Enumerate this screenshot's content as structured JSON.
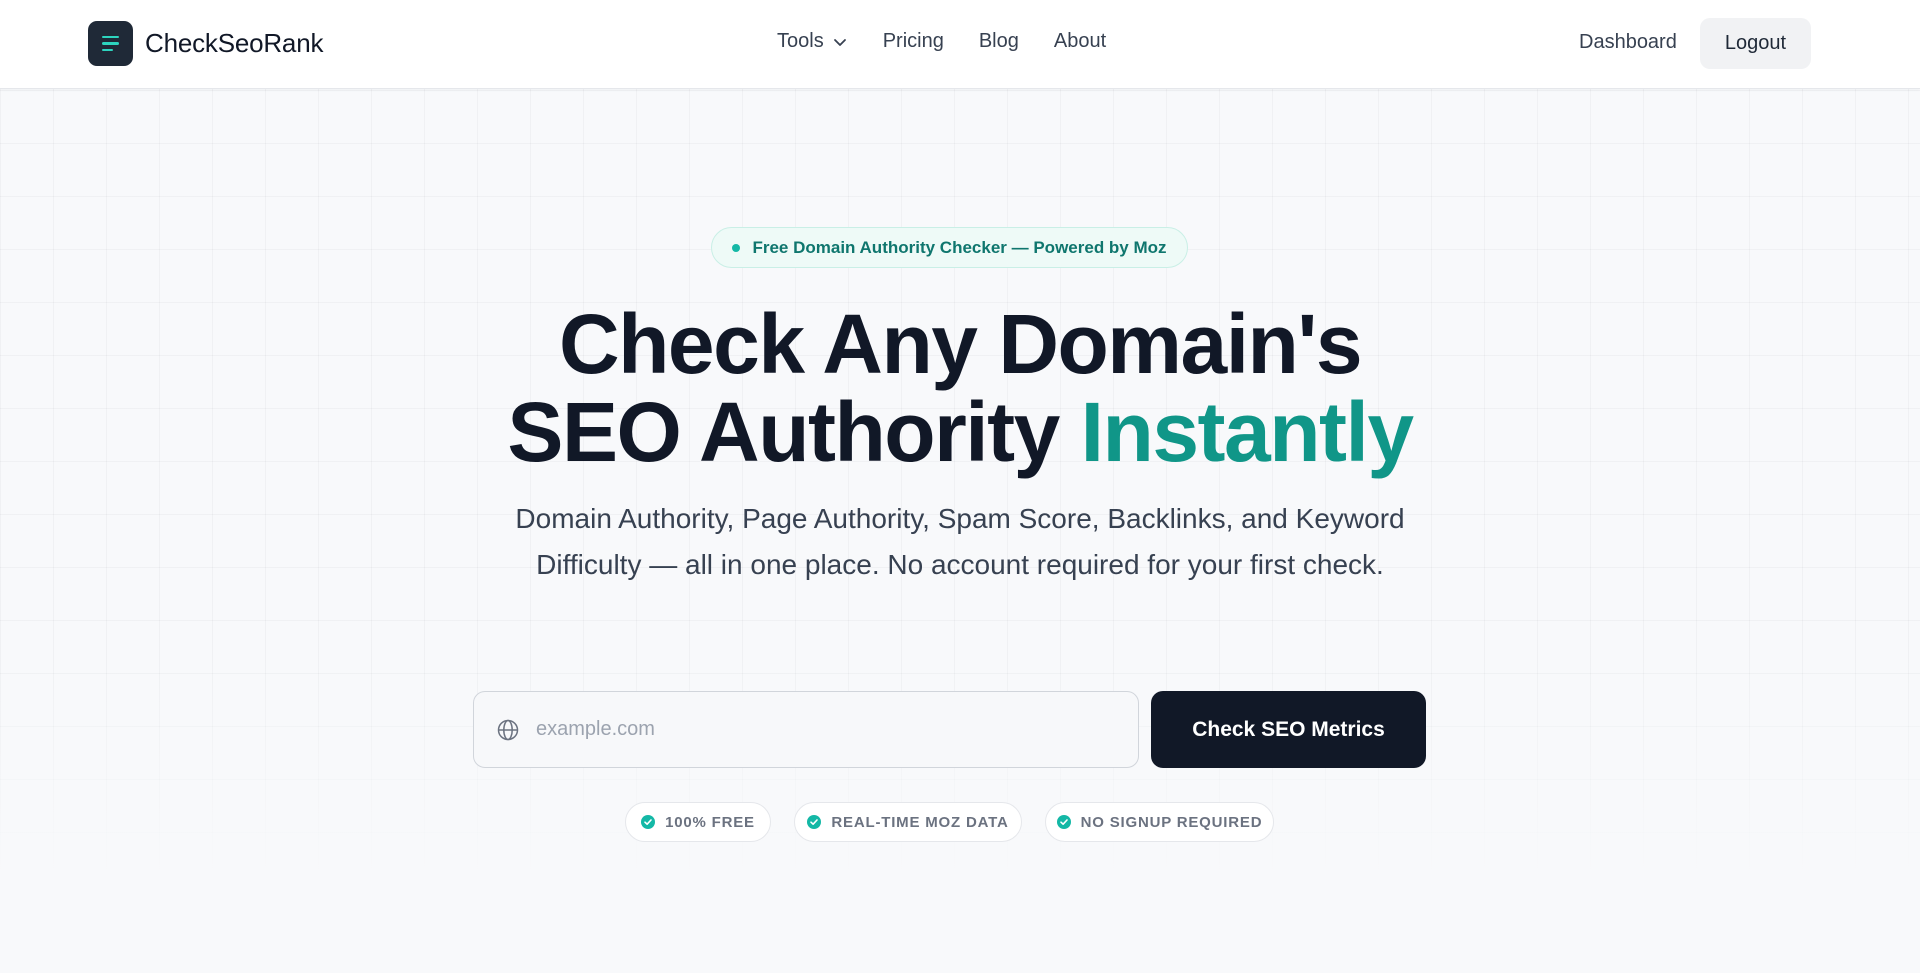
{
  "header": {
    "brand": "CheckSeoRank",
    "nav": [
      {
        "label": "Tools",
        "has_dropdown": true
      },
      {
        "label": "Pricing"
      },
      {
        "label": "Blog"
      },
      {
        "label": "About"
      }
    ],
    "dashboard_label": "Dashboard",
    "logout_label": "Logout"
  },
  "hero": {
    "badge": "Free Domain Authority Checker — Powered by Moz",
    "headline_line1": "Check Any Domain's",
    "headline_line2_plain": "SEO Authority",
    "headline_line2_accent": "Instantly",
    "subtitle": "Domain Authority, Page Authority, Spam Score, Backlinks, and Keyword Difficulty — all in one place. No account required for your first check."
  },
  "search": {
    "placeholder": "example.com",
    "value": "",
    "button_label": "Check SEO Metrics"
  },
  "features": [
    "100% FREE",
    "REAL-TIME MOZ DATA",
    "NO SIGNUP REQUIRED"
  ],
  "colors": {
    "accent": "#109688",
    "dark": "#111827",
    "badge_bg": "#eefaf7",
    "check_icon": "#14b8a6"
  },
  "icons": {
    "logo": "menu-lines-icon",
    "tools_dropdown": "chevron-down-icon",
    "search_prefix": "globe-icon",
    "feature": "check-circle-icon"
  }
}
